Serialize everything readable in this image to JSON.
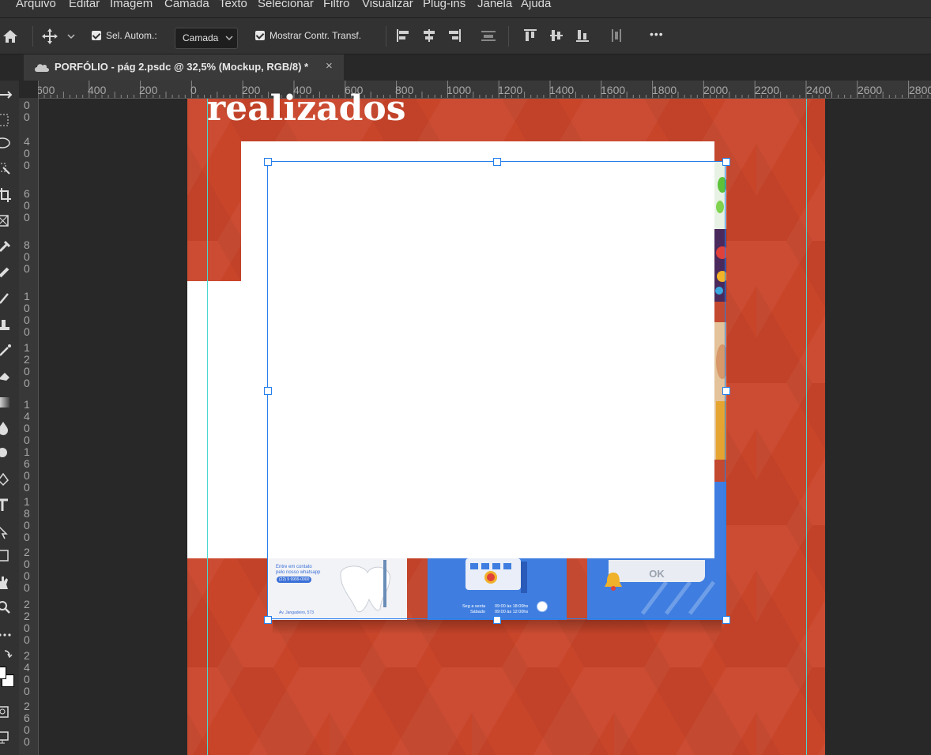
{
  "menu": [
    "Arquivo",
    "Editar",
    "Imagem",
    "Camada",
    "Texto",
    "Selecionar",
    "Filtro",
    "Visualizar",
    "Plug-ins",
    "Janela",
    "Ajuda"
  ],
  "options": {
    "auto_select_label": "Sel. Autom.:",
    "layer_dropdown_value": "Camada",
    "show_transform_label": "Mostrar Contr. Transf.",
    "more": "•••"
  },
  "document_tab": {
    "title": "PORFÓLIO - pág 2.psdc @ 32,5% (Mockup, RGB/8) *",
    "close": "×"
  },
  "ruler": {
    "horizontal": [
      "600",
      "400",
      "200",
      "0",
      "200",
      "400",
      "600",
      "800",
      "1000",
      "1200",
      "1400",
      "1600",
      "1800",
      "2000",
      "2200",
      "2400",
      "2600",
      "2800"
    ],
    "vertical": [
      [
        "0",
        "0"
      ],
      [
        "4",
        "0",
        "0"
      ],
      [
        "6",
        "0",
        "0"
      ],
      [
        "8",
        "0",
        "0"
      ],
      [
        "1",
        "0",
        "0",
        "0"
      ],
      [
        "1",
        "2",
        "0",
        "0"
      ],
      [
        "1",
        "4",
        "0",
        "0"
      ],
      [
        "1",
        "6",
        "0",
        "0"
      ],
      [
        "1",
        "8",
        "0",
        "0"
      ],
      [
        "2",
        "0",
        "0",
        "0"
      ],
      [
        "2",
        "2",
        "0",
        "0"
      ],
      [
        "2",
        "4",
        "0",
        "0"
      ],
      [
        "2",
        "6",
        "0",
        "0"
      ]
    ]
  },
  "canvas": {
    "heading": "realizados",
    "card1_text1": "Entre em contato",
    "card1_text2": "pelo nosso whatsapp",
    "card1_phone": "(22) 9 9999-0000",
    "card1_address": "Av. Jangadeiro, 573",
    "card2_days1": "Seg a sexta",
    "card2_days2": "Sábado",
    "card2_hours1": "09:00 às 18:00hs",
    "card2_hours2": "09:00 às 12:00hs",
    "card3_ok": "OK"
  },
  "colors": {
    "artboard": "#c9452a",
    "selection": "#2680eb",
    "guide": "#48d8d0",
    "card_blue": "#3f7ee0"
  }
}
